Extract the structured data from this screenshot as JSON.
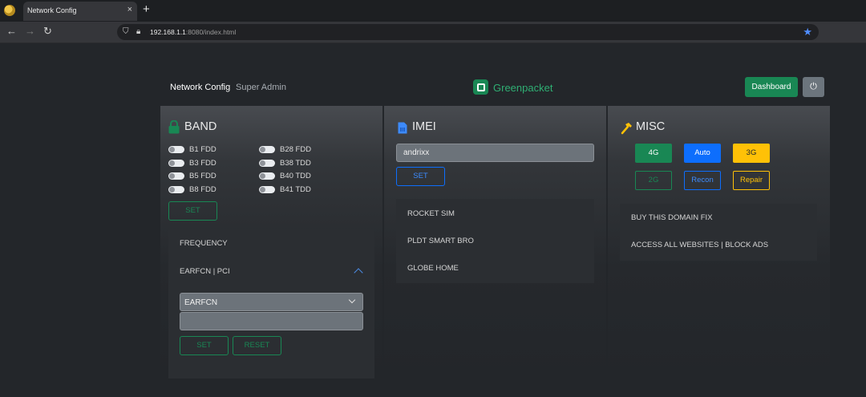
{
  "browser": {
    "tab_title": "Network Config",
    "tab_close": "×",
    "new_tab": "+",
    "url_host": "192.168.1.1",
    "url_rest": ":8080/index.html"
  },
  "nav": {
    "brand": "Network Config",
    "link": "Super Admin",
    "logo_text": "Greenpacket",
    "dashboard_label": "Dashboard",
    "power_label": "⏻"
  },
  "band": {
    "title": "BAND",
    "bands_left": [
      "B1 FDD",
      "B3 FDD",
      "B5 FDD",
      "B8 FDD"
    ],
    "bands_right": [
      "B28 FDD",
      "B38 TDD",
      "B40 TDD",
      "B41 TDD"
    ],
    "set_label": "SET",
    "frequency_label": "FREQUENCY",
    "earfcn_pci_label": "EARFCN | PCI",
    "select_value": "EARFCN",
    "input_value": "",
    "set2_label": "SET",
    "reset_label": "RESET"
  },
  "imei": {
    "title": "IMEI",
    "value": "andrixx",
    "set_label": "SET",
    "items": [
      "ROCKET SIM",
      "PLDT SMART BRO",
      "GLOBE HOME"
    ]
  },
  "misc": {
    "title": "MISC",
    "btn_4g": "4G",
    "btn_auto": "Auto",
    "btn_3g": "3G",
    "btn_2g": "2G",
    "btn_recon": "Recon",
    "btn_repair": "Repair",
    "items": [
      "BUY THIS DOMAIN FIX",
      "ACCESS ALL WEBSITES | BLOCK ADS"
    ]
  },
  "colors": {
    "success": "#198754",
    "primary": "#0d6efd",
    "warning": "#ffc107",
    "secondary": "#6c757d"
  }
}
